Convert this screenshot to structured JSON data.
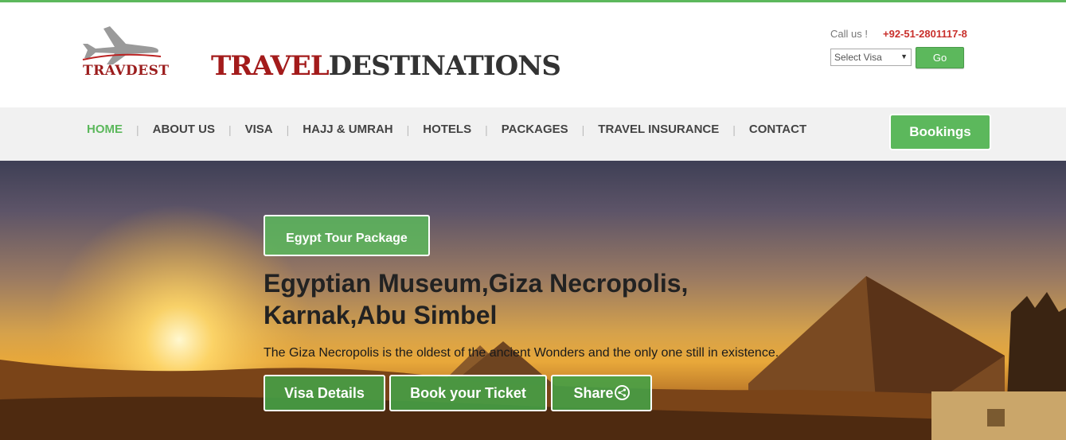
{
  "header": {
    "logo_text": "TRAVDEST",
    "brand_part1": "TRAVEL",
    "brand_part2": "DESTINATIONS",
    "call_label": "Call us !",
    "phone": "+92-51-2801117-8",
    "visa_select": "Select Visa",
    "go_label": "Go"
  },
  "nav": {
    "items": [
      {
        "label": "HOME",
        "active": true
      },
      {
        "label": "ABOUT US"
      },
      {
        "label": "VISA"
      },
      {
        "label": "HAJJ & UMRAH"
      },
      {
        "label": "HOTELS"
      },
      {
        "label": "PACKAGES"
      },
      {
        "label": "TRAVEL INSURANCE"
      },
      {
        "label": "CONTACT"
      }
    ],
    "separator": "|",
    "bookings_label": "Bookings"
  },
  "hero": {
    "package_label": "Egypt Tour Package",
    "title": "Egyptian Museum,Giza Necropolis, Karnak,Abu Simbel",
    "description": "The Giza Necropolis is the oldest of the ancient Wonders and the only one still in existence.",
    "buttons": {
      "visa": "Visa Details",
      "book": "Book your Ticket",
      "share": "Share"
    }
  },
  "colors": {
    "accent": "#5cb85c",
    "brand_red": "#a31b1b",
    "phone_red": "#c9302c"
  }
}
